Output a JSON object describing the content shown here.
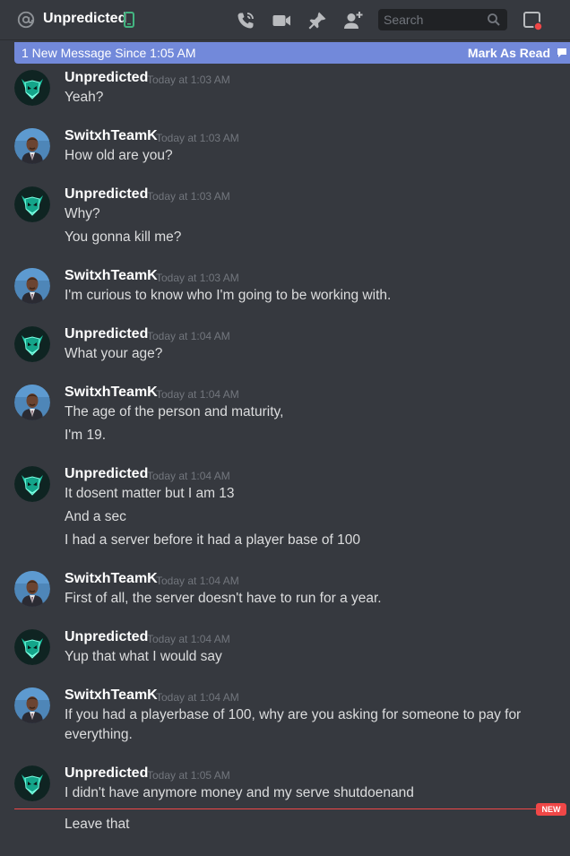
{
  "header": {
    "title": "Unpredicted",
    "icons": [
      "at-icon",
      "mobile-online-icon",
      "call-icon",
      "video-icon",
      "pin-icon",
      "add-member-icon",
      "inbox-icon"
    ],
    "search_placeholder": "Search"
  },
  "new_messages_bar": {
    "text": "1 New Message Since 1:05 AM",
    "action": "Mark As Read"
  },
  "messages": [
    {
      "author": "Unpredicted",
      "time": "Today at 1:03 AM",
      "lines": [
        "Yeah?"
      ]
    },
    {
      "author": "SwitxhTeamK",
      "time": "Today at 1:03 AM",
      "lines": [
        "How old are you?"
      ]
    },
    {
      "author": "Unpredicted",
      "time": "Today at 1:03 AM",
      "lines": [
        "Why?",
        "You gonna kill me?"
      ]
    },
    {
      "author": "SwitxhTeamK",
      "time": "Today at 1:03 AM",
      "lines": [
        "I'm curious to know who I'm going to be working with."
      ]
    },
    {
      "author": "Unpredicted",
      "time": "Today at 1:04 AM",
      "lines": [
        "What your age?"
      ]
    },
    {
      "author": "SwitxhTeamK",
      "time": "Today at 1:04 AM",
      "lines": [
        "The age of the person and maturity,",
        "I'm 19."
      ]
    },
    {
      "author": "Unpredicted",
      "time": "Today at 1:04 AM",
      "lines": [
        "It dosent matter but I am 13",
        "And a sec",
        "I had a server before it had a player base of 100"
      ]
    },
    {
      "author": "SwitxhTeamK",
      "time": "Today at 1:04 AM",
      "lines": [
        "First of all, the server doesn't have to run for a year."
      ]
    },
    {
      "author": "Unpredicted",
      "time": "Today at 1:04 AM",
      "lines": [
        "Yup that what I would say"
      ]
    },
    {
      "author": "SwitxhTeamK",
      "time": "Today at 1:04 AM",
      "lines": [
        "If you had a playerbase of 100, why are you asking for someone to pay for",
        "everything."
      ]
    },
    {
      "author": "Unpredicted",
      "time": "Today at 1:05 AM",
      "lines": [
        "I didn't have anymore money and my serve shutdoenand",
        "Leave that"
      ]
    }
  ],
  "new_badge": "NEW",
  "colors": {
    "background": "#36393f",
    "accent_bar": "#7289da",
    "new_divider": "#f04747",
    "online_mobile": "#43b581"
  }
}
